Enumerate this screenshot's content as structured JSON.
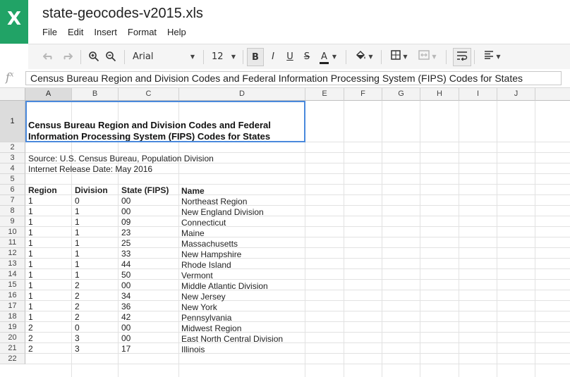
{
  "app": {
    "logo_letter": "X",
    "title": "state-geocodes-v2015.xls"
  },
  "menu": [
    "File",
    "Edit",
    "Insert",
    "Format",
    "Help"
  ],
  "toolbar": {
    "font": "Arial",
    "size": "12",
    "bold": "B",
    "italic": "I",
    "underline": "U",
    "strike": "S",
    "text_color": "A",
    "icons": [
      "undo-icon",
      "redo-icon",
      "zoom-in-icon",
      "zoom-out-icon",
      "fill-color-icon",
      "borders-icon",
      "merge-cells-icon",
      "wrap-text-icon",
      "align-left-icon"
    ]
  },
  "formula_bar": {
    "fx": "f",
    "fx_sup": "x",
    "value": "Census Bureau Region and Division Codes and Federal Information Processing System (FIPS) Codes for States"
  },
  "columns": [
    "A",
    "B",
    "C",
    "D",
    "E",
    "F",
    "G",
    "H",
    "I",
    "J"
  ],
  "row_numbers": [
    "1",
    "2",
    "3",
    "4",
    "5",
    "6",
    "7",
    "8",
    "9",
    "10",
    "11",
    "12",
    "13",
    "14",
    "15",
    "16",
    "17",
    "18",
    "19",
    "20",
    "21",
    "22"
  ],
  "sheet": {
    "title_line1": "Census Bureau Region and Division Codes and Federal",
    "title_line2": "Information Processing System (FIPS) Codes for States",
    "source": "Source: U.S. Census Bureau, Population Division",
    "release": "Internet Release Date: May 2016",
    "headers": [
      "Region",
      "Division",
      "State (FIPS)",
      "Name"
    ],
    "rows": [
      [
        "1",
        "0",
        "00",
        "Northeast Region"
      ],
      [
        "1",
        "1",
        "00",
        "New England Division"
      ],
      [
        "1",
        "1",
        "09",
        "Connecticut"
      ],
      [
        "1",
        "1",
        "23",
        "Maine"
      ],
      [
        "1",
        "1",
        "25",
        "Massachusetts"
      ],
      [
        "1",
        "1",
        "33",
        "New Hampshire"
      ],
      [
        "1",
        "1",
        "44",
        "Rhode Island"
      ],
      [
        "1",
        "1",
        "50",
        "Vermont"
      ],
      [
        "1",
        "2",
        "00",
        "Middle Atlantic Division"
      ],
      [
        "1",
        "2",
        "34",
        "New Jersey"
      ],
      [
        "1",
        "2",
        "36",
        "New York"
      ],
      [
        "1",
        "2",
        "42",
        "Pennsylvania"
      ],
      [
        "2",
        "0",
        "00",
        "Midwest Region"
      ],
      [
        "2",
        "3",
        "00",
        "East North Central Division"
      ],
      [
        "2",
        "3",
        "17",
        "Illinois"
      ]
    ]
  }
}
